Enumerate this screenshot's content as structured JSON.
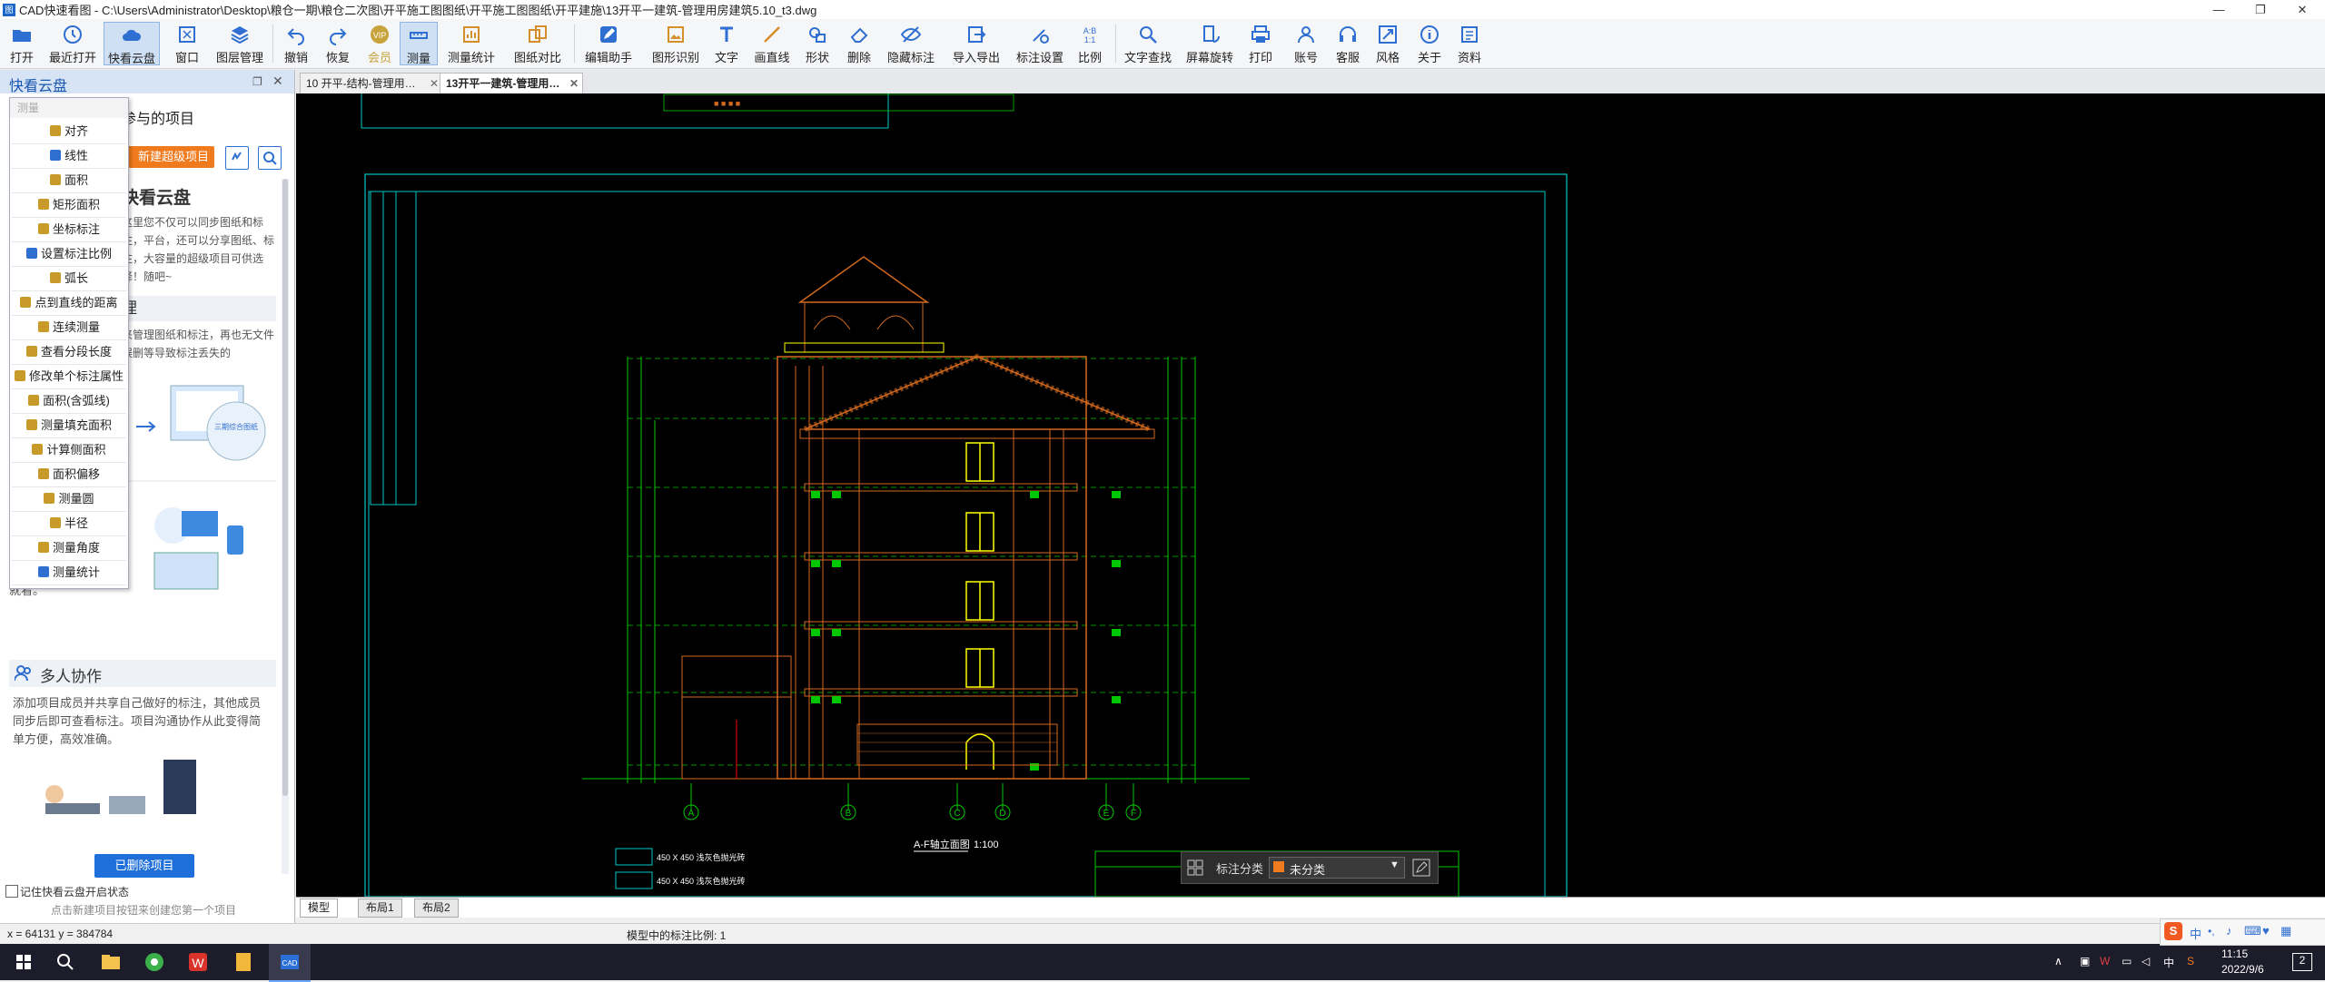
{
  "window": {
    "title": "CAD快速看图 - C:\\Users\\Administrator\\Desktop\\粮仓一期\\粮仓二次图\\开平施工图图纸\\开平施工图图纸\\开平建施\\13开平一建筑-管理用房建筑5.10_t3.dwg"
  },
  "toolbar": {
    "items": [
      {
        "label": "打开"
      },
      {
        "label": "最近打开"
      },
      {
        "label": "快看云盘"
      },
      {
        "label": "窗口"
      },
      {
        "label": "图层管理"
      },
      {
        "label": "撤销"
      },
      {
        "label": "恢复"
      },
      {
        "label": "会员"
      },
      {
        "label": "测量"
      },
      {
        "label": "测量统计"
      },
      {
        "label": "图纸对比"
      },
      {
        "label": "编辑助手"
      },
      {
        "label": "图形识别"
      },
      {
        "label": "文字"
      },
      {
        "label": "画直线"
      },
      {
        "label": "形状"
      },
      {
        "label": "删除"
      },
      {
        "label": "隐藏标注"
      },
      {
        "label": "导入导出"
      },
      {
        "label": "标注设置"
      },
      {
        "label": "比例"
      },
      {
        "label": "文字查找"
      },
      {
        "label": "屏幕旋转"
      },
      {
        "label": "打印"
      },
      {
        "label": "账号"
      },
      {
        "label": "客服"
      },
      {
        "label": "风格"
      },
      {
        "label": "关于"
      },
      {
        "label": "资料"
      }
    ],
    "active_index": 8,
    "vip_label": "VIP"
  },
  "left_panel": {
    "title": "快看云盘",
    "subtitle": "参与的项目",
    "new_project_btn": "新建超级项目",
    "cloud_heading": "快看云盘",
    "cloud_text": "这里您不仅可以同步图纸和标注，平台，还可以分享图纸、标注，大容量的超级项目可供选择！随吧~",
    "manage_heading": "理",
    "manage_text": "来管理图纸和标注，再也无文件误删等导致标注丢失的",
    "share_text": "板，各个平台图纸标注共享，随时随地，想看就看。",
    "collab_heading": "多人协作",
    "collab_text": "添加项目成员并共享自己做好的标注，其他成员同步后即可查看标注。项目沟通协作从此变得简单方便，高效准确。",
    "deleted_btn": "已删除项目",
    "remember_label": "记住快看云盘开启状态",
    "hint": "点击新建项目按钮来创建您第一个项目",
    "promo_badge": "三期综合图纸"
  },
  "measure_dropdown": {
    "header": "测量",
    "items": [
      "对齐",
      "线性",
      "面积",
      "矩形面积",
      "坐标标注",
      "设置标注比例",
      "弧长",
      "点到直线的距离",
      "连续测量",
      "查看分段长度",
      "修改单个标注属性",
      "面积(含弧线)",
      "测量填充面积",
      "计算侧面积",
      "面积偏移",
      "测量圆",
      "半径",
      "测量角度",
      "测量统计"
    ]
  },
  "doc_tabs": [
    {
      "label": "10 开平-结构-管理用…",
      "close": "✕"
    },
    {
      "label": "13开平一建筑-管理用…",
      "close": "✕"
    }
  ],
  "drawing": {
    "title": "A-F轴立面图",
    "scale": "1:100",
    "axes": [
      "A",
      "B",
      "C",
      "D",
      "E",
      "F"
    ],
    "legend": [
      "450 X 450 浅灰色抛光砖",
      "450 X 450 浅灰色抛光砖"
    ]
  },
  "annotation_bar": {
    "label": "标注分类",
    "value": "未分类"
  },
  "layout_tabs": [
    "模型",
    "布局1",
    "布局2"
  ],
  "status": {
    "coords": "x = 64131  y = 384784",
    "scale_text": "模型中的标注比例: 1"
  },
  "taskbar": {
    "ime": "中",
    "time": "11:15",
    "date": "2022/9/6",
    "notify": "2"
  },
  "colors": {
    "accent": "#1e6fd9",
    "orange_btn": "#f07a1e",
    "cad_bg": "#000000",
    "cad_orange": "#d2691e",
    "cad_green": "#00c800",
    "cad_yellow": "#ffff00",
    "cad_cyan": "#00c8c8"
  }
}
